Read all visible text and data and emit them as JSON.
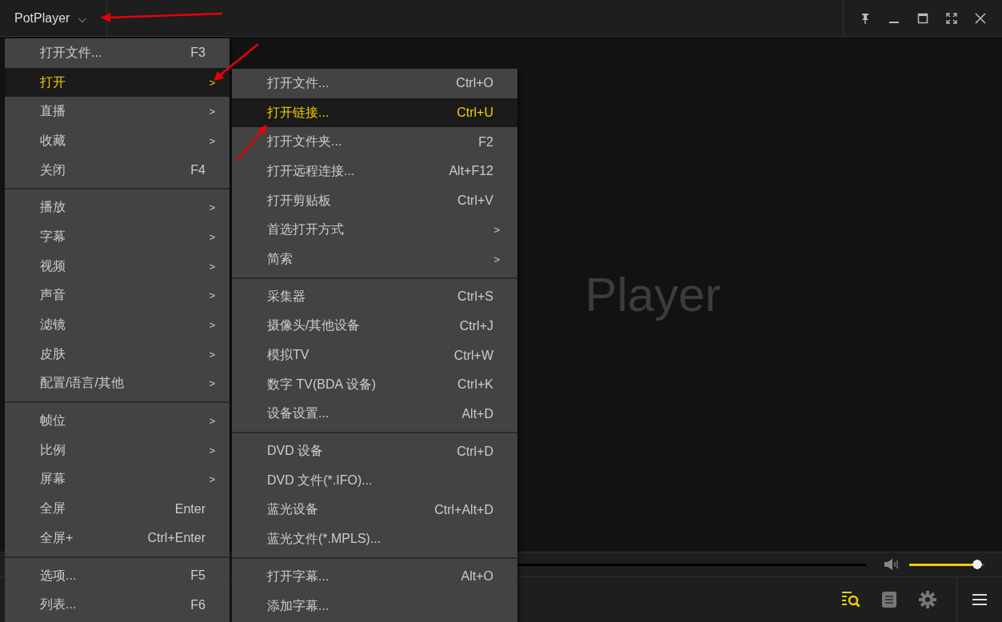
{
  "window": {
    "title": "PotPlayer",
    "title_caret": "⌵"
  },
  "background_logo": "Player",
  "main_menu": [
    {
      "kind": "item",
      "label": "打开文件...",
      "shortcut": "F3",
      "selected": false
    },
    {
      "kind": "item",
      "label": "打开",
      "submenu_mark": ">",
      "selected": true
    },
    {
      "kind": "item",
      "label": "直播",
      "submenu_mark": ">",
      "selected": false
    },
    {
      "kind": "item",
      "label": "收藏",
      "submenu_mark": ">",
      "selected": false
    },
    {
      "kind": "item",
      "label": "关闭",
      "shortcut": "F4",
      "selected": false
    },
    {
      "kind": "separator"
    },
    {
      "kind": "item",
      "label": "播放",
      "submenu_mark": ">",
      "selected": false
    },
    {
      "kind": "item",
      "label": "字幕",
      "submenu_mark": ">",
      "selected": false
    },
    {
      "kind": "item",
      "label": "视频",
      "submenu_mark": ">",
      "selected": false
    },
    {
      "kind": "item",
      "label": "声音",
      "submenu_mark": ">",
      "selected": false
    },
    {
      "kind": "item",
      "label": "滤镜",
      "submenu_mark": ">",
      "selected": false
    },
    {
      "kind": "item",
      "label": "皮肤",
      "submenu_mark": ">",
      "selected": false
    },
    {
      "kind": "item",
      "label": "配置/语言/其他",
      "submenu_mark": ">",
      "selected": false
    },
    {
      "kind": "separator"
    },
    {
      "kind": "item",
      "label": "帧位",
      "submenu_mark": ">",
      "selected": false
    },
    {
      "kind": "item",
      "label": "比例",
      "submenu_mark": ">",
      "selected": false
    },
    {
      "kind": "item",
      "label": "屏幕",
      "submenu_mark": ">",
      "selected": false
    },
    {
      "kind": "item",
      "label": "全屏",
      "shortcut": "Enter",
      "selected": false
    },
    {
      "kind": "item",
      "label": "全屏+",
      "shortcut": "Ctrl+Enter",
      "selected": false
    },
    {
      "kind": "separator"
    },
    {
      "kind": "item",
      "label": "选项...",
      "shortcut": "F5",
      "selected": false
    },
    {
      "kind": "item",
      "label": "列表...",
      "shortcut": "F6",
      "selected": false
    }
  ],
  "submenu": [
    {
      "kind": "item",
      "label": "打开文件...",
      "shortcut": "Ctrl+O",
      "selected": false
    },
    {
      "kind": "item",
      "label": "打开链接...",
      "shortcut": "Ctrl+U",
      "selected": true
    },
    {
      "kind": "item",
      "label": "打开文件夹...",
      "shortcut": "F2",
      "selected": false
    },
    {
      "kind": "item",
      "label": "打开远程连接...",
      "shortcut": "Alt+F12",
      "selected": false
    },
    {
      "kind": "item",
      "label": "打开剪贴板",
      "shortcut": "Ctrl+V",
      "selected": false
    },
    {
      "kind": "item",
      "label": "首选打开方式",
      "submenu_mark": ">",
      "selected": false
    },
    {
      "kind": "item",
      "label": "简索",
      "submenu_mark": ">",
      "selected": false
    },
    {
      "kind": "separator"
    },
    {
      "kind": "item",
      "label": "采集器",
      "shortcut": "Ctrl+S",
      "selected": false
    },
    {
      "kind": "item",
      "label": "摄像头/其他设备",
      "shortcut": "Ctrl+J",
      "selected": false
    },
    {
      "kind": "item",
      "label": "模拟TV",
      "shortcut": "Ctrl+W",
      "selected": false
    },
    {
      "kind": "item",
      "label": "数字 TV(BDA 设备)",
      "shortcut": "Ctrl+K",
      "selected": false
    },
    {
      "kind": "item",
      "label": "设备设置...",
      "shortcut": "Alt+D",
      "selected": false
    },
    {
      "kind": "separator"
    },
    {
      "kind": "item",
      "label": "DVD 设备",
      "shortcut": "Ctrl+D",
      "selected": false
    },
    {
      "kind": "item",
      "label": "DVD 文件(*.IFO)...",
      "selected": false
    },
    {
      "kind": "item",
      "label": "蓝光设备",
      "shortcut": "Ctrl+Alt+D",
      "selected": false
    },
    {
      "kind": "item",
      "label": "蓝光文件(*.MPLS)...",
      "selected": false
    },
    {
      "kind": "separator"
    },
    {
      "kind": "item",
      "label": "打开字幕...",
      "shortcut": "Alt+O",
      "selected": false
    },
    {
      "kind": "item",
      "label": "添加字幕...",
      "selected": false
    }
  ],
  "volume": {
    "level": 0.97
  }
}
